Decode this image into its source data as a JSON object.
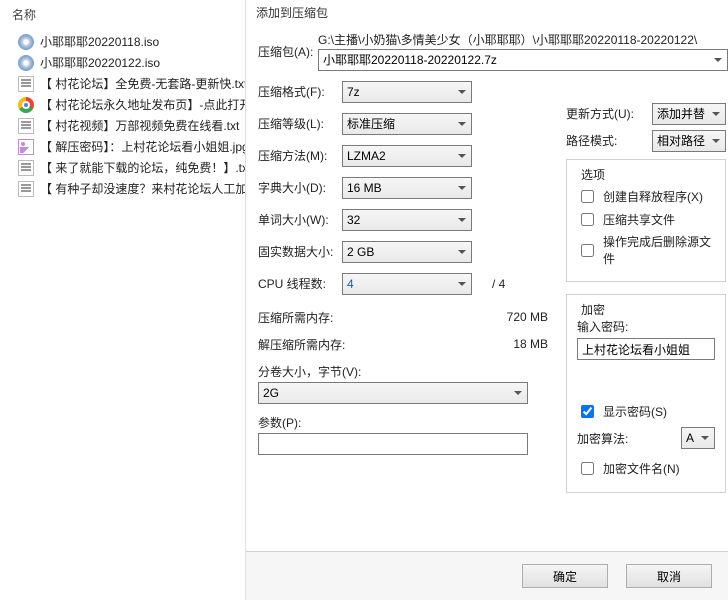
{
  "left": {
    "header": "名称",
    "files": [
      {
        "icon": "disc",
        "name": "小耶耶耶20220118.iso"
      },
      {
        "icon": "disc",
        "name": "小耶耶耶20220122.iso"
      },
      {
        "icon": "txt",
        "name": "【 村花论坛】全免费-无套路-更新快.txt"
      },
      {
        "icon": "chrome",
        "name": "【 村花论坛永久地址发布页】-点此打开"
      },
      {
        "icon": "txt",
        "name": "【 村花视频】万部视频免费在线看.txt"
      },
      {
        "icon": "jpg",
        "name": "【 解压密码】：上村花论坛看小姐姐.jpg"
      },
      {
        "icon": "txt",
        "name": "【 来了就能下载的论坛，纯免费！】.txt"
      },
      {
        "icon": "txt",
        "name": "【 有种子却没速度？来村花论坛人工加…"
      }
    ]
  },
  "dlg": {
    "title": "添加到压缩包",
    "archive_label": "压缩包(A):",
    "archive_dir": "G:\\主播\\小奶猫\\多情美少女（小耶耶耶）\\小耶耶耶20220118-20220122\\",
    "archive_name": "小耶耶耶20220118-20220122.7z",
    "format_label": "压缩格式(F):",
    "format_val": "7z",
    "level_label": "压缩等级(L):",
    "level_val": "标准压缩",
    "method_label": "压缩方法(M):",
    "method_val": "LZMA2",
    "dict_label": "字典大小(D):",
    "dict_val": "16 MB",
    "word_label": "单词大小(W):",
    "word_val": "32",
    "solid_label": "固实数据大小:",
    "solid_val": "2 GB",
    "cpu_label": "CPU 线程数:",
    "cpu_val": "4",
    "cpu_max": "/ 4",
    "mem_c_label": "压缩所需内存:",
    "mem_c_val": "720 MB",
    "mem_d_label": "解压缩所需内存:",
    "mem_d_val": "18 MB",
    "split_label": "分卷大小，字节(V):",
    "split_val": "2G",
    "param_label": "参数(P):",
    "update_label": "更新方式(U):",
    "update_val": "添加并替",
    "path_label": "路径模式:",
    "path_val": "相对路径",
    "opts_title": "选项",
    "opt_sfx": "创建自释放程序(X)",
    "opt_share": "压缩共享文件",
    "opt_del": "操作完成后删除源文件",
    "enc_title": "加密",
    "pwd_label": "输入密码:",
    "pwd_val": "上村花论坛看小姐姐",
    "showpwd": "显示密码(S)",
    "encmethod_label": "加密算法:",
    "encmethod_val": "AE",
    "encnames": "加密文件名(N)",
    "ok": "确定",
    "cancel": "取消"
  }
}
